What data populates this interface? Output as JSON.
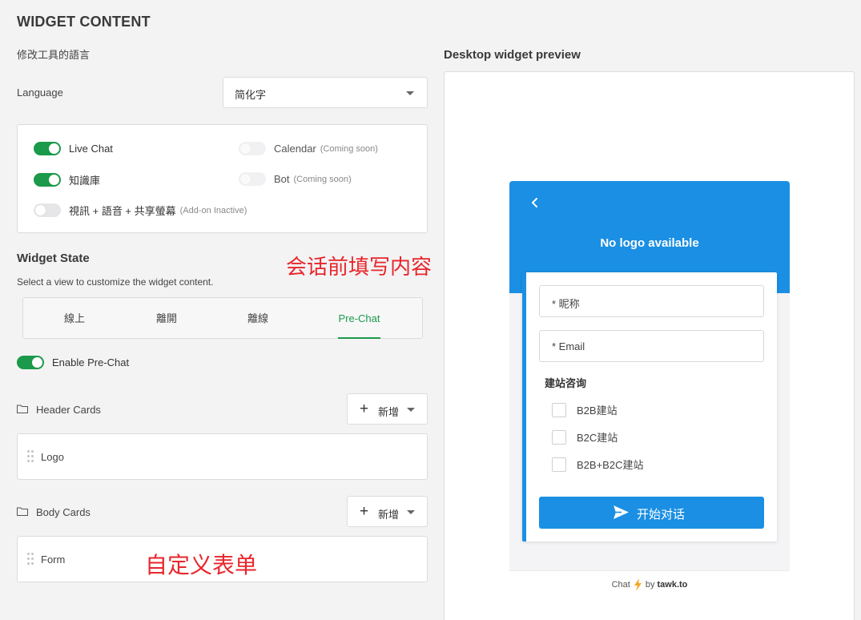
{
  "page": {
    "title": "WIDGET CONTENT",
    "language_prompt": "修改工具的語言",
    "language_label": "Language",
    "language_value": "简化字"
  },
  "features": [
    {
      "label": "Live Chat",
      "note": "",
      "enabled": true
    },
    {
      "label": "Calendar",
      "note": "(Coming soon)",
      "enabled": false
    },
    {
      "label": "知識庫",
      "note": "",
      "enabled": true
    },
    {
      "label": "Bot",
      "note": "(Coming soon)",
      "enabled": false
    },
    {
      "label": "視訊 + 語音 + 共享螢幕",
      "note": "(Add-on Inactive)",
      "enabled": false
    }
  ],
  "widget_state": {
    "title": "Widget State",
    "subtitle": "Select a view to customize the widget content.",
    "tabs": [
      {
        "label": "線上",
        "active": false
      },
      {
        "label": "離開",
        "active": false
      },
      {
        "label": "離線",
        "active": false
      },
      {
        "label": "Pre-Chat",
        "active": true
      }
    ],
    "enable_label": "Enable Pre-Chat",
    "enable_on": true
  },
  "header_cards": {
    "label": "Header Cards",
    "add_label": "新增",
    "items": [
      "Logo"
    ]
  },
  "body_cards": {
    "label": "Body Cards",
    "add_label": "新增",
    "items": [
      "Form"
    ]
  },
  "annotations": {
    "prechat_note": "会话前填写内容",
    "form_note": "自定义表单"
  },
  "preview": {
    "title": "Desktop widget preview",
    "header_text": "No logo available",
    "fields": [
      "* 昵称",
      "* Email"
    ],
    "group_label": "建站咨询",
    "options": [
      "B2B建站",
      "B2C建站",
      "B2B+B2C建站"
    ],
    "submit_label": "开始对话",
    "footer_prefix": "Chat",
    "footer_by": "by",
    "footer_brand": "tawk.to"
  },
  "colors": {
    "accent_green": "#1a9a4a",
    "widget_blue": "#1a8fe3",
    "annotation_red": "#e8262b"
  }
}
